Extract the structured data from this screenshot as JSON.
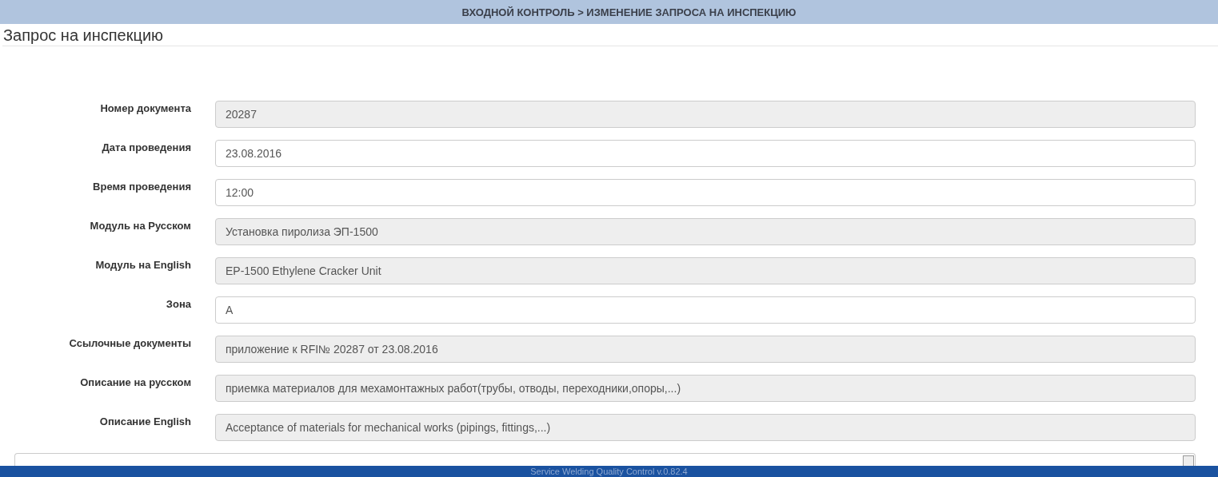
{
  "header": {
    "title": "ВХОДНОЙ КОНТРОЛЬ > ИЗМЕНЕНИЕ ЗАПРОСА НА ИНСПЕКЦИЮ"
  },
  "page_title": "Запрос на инспекцию",
  "fields": [
    {
      "label": "Номер документа",
      "value": "20287",
      "readonly": true
    },
    {
      "label": "Дата проведения",
      "value": "23.08.2016",
      "readonly": false
    },
    {
      "label": "Время проведения",
      "value": "12:00",
      "readonly": false
    },
    {
      "label": "Модуль на Русском",
      "value": "Установка пиролиза ЭП-1500",
      "readonly": true
    },
    {
      "label": "Модуль на English",
      "value": "EP-1500 Ethylene Cracker Unit",
      "readonly": true
    },
    {
      "label": "Зона",
      "value": "A",
      "readonly": false
    },
    {
      "label": "Ссылочные документы",
      "value": "приложение к RFI№ 20287 от 23.08.2016",
      "readonly": true
    },
    {
      "label": "Описание на русском",
      "value": "приемка материалов для мехамонтажных работ(трубы, отводы, переходники,опоры,...)",
      "readonly": true
    },
    {
      "label": "Описание English",
      "value": "Acceptance of materials for mechanical works (pipings, fittings,...)",
      "readonly": true
    }
  ],
  "footer": {
    "text": "Service Welding Quality Control v.0.82.4"
  }
}
